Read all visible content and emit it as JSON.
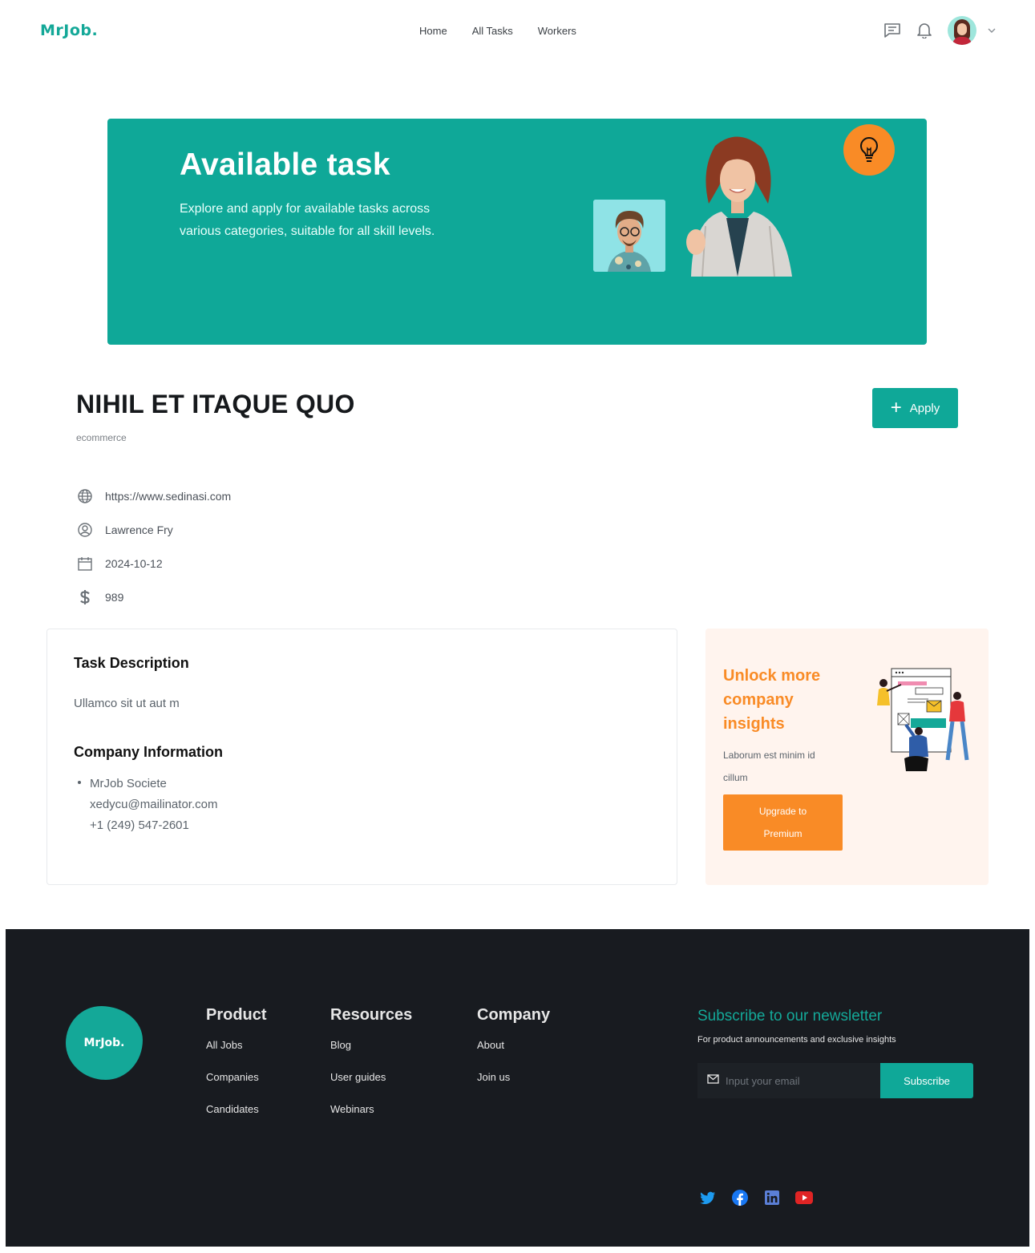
{
  "header": {
    "logo": "MrJob.",
    "nav": [
      "Home",
      "All Tasks",
      "Workers"
    ],
    "icons": [
      "chat-icon",
      "bell-icon",
      "avatar",
      "chevron-down-icon"
    ]
  },
  "hero": {
    "title": "Available task",
    "subtitle": "Explore and apply for available tasks across various categories, suitable for all skill levels.",
    "accent": "#0fa898",
    "bulb_color": "#f98b26"
  },
  "task": {
    "title": "NIHIL ET ITAQUE QUO",
    "category": "ecommerce",
    "apply_label": "Apply",
    "meta": {
      "website": "https://www.sedinasi.com",
      "person": "Lawrence Fry",
      "date": "2024-10-12",
      "budget": "989"
    }
  },
  "description": {
    "heading": "Task Description",
    "text": "Ullamco sit ut aut m",
    "company_heading": "Company Information",
    "company_name": "MrJob Societe",
    "company_email": "xedycu@mailinator.com",
    "company_phone": "+1 (249) 547-2601"
  },
  "promo": {
    "title": "Unlock more company insights",
    "text": "Laborum est minim id cillum",
    "button": "Upgrade to Premium"
  },
  "footer": {
    "logo": "MrJob.",
    "product": {
      "heading": "Product",
      "links": [
        "All Jobs",
        "Companies",
        "Candidates"
      ]
    },
    "resources": {
      "heading": "Resources",
      "links": [
        "Blog",
        "User guides",
        "Webinars"
      ]
    },
    "company": {
      "heading": "Company",
      "links": [
        "About",
        "Join us"
      ]
    },
    "newsletter": {
      "title": "Subscribe to our newsletter",
      "subtitle": "For product announcements and exclusive insights",
      "placeholder": "Input your email",
      "button": "Subscribe"
    },
    "socials": [
      "twitter-icon",
      "facebook-icon",
      "linkedin-icon",
      "youtube-icon"
    ]
  }
}
